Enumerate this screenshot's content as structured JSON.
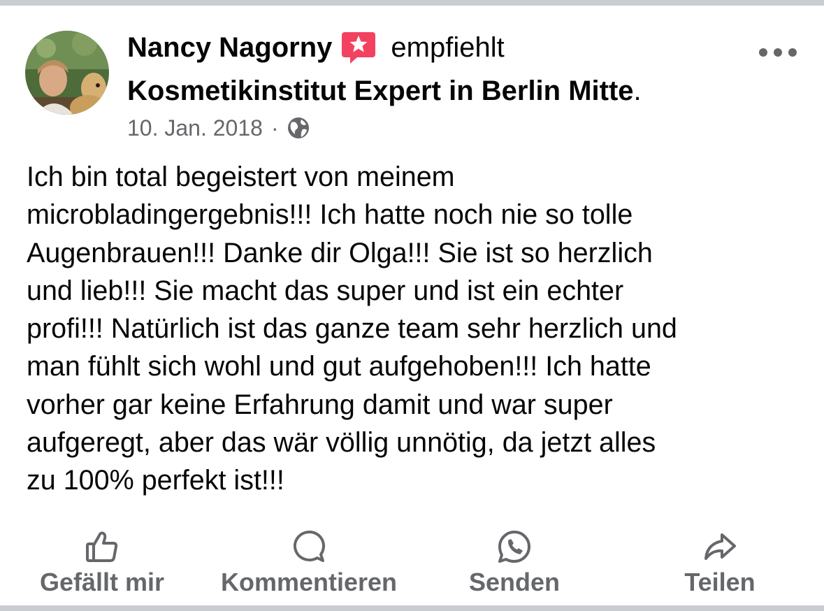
{
  "post": {
    "author": "Nancy Nagorny",
    "action_text": "empfiehlt",
    "page_name": "Kosmetikinstitut Expert in Berlin Mitte",
    "page_suffix": ".",
    "date": "10. Jan. 2018",
    "separator": "·",
    "privacy_icon": "globe-icon",
    "recommend_icon": "recommendation-star-icon",
    "menu_icon": "more-options-icon",
    "body_lines": [
      "Ich bin total begeistert von meinem",
      "microbladingergebnis!!! Ich hatte noch nie so tolle",
      "Augenbrauen!!! Danke dir Olga!!! Sie ist so herzlich",
      "und lieb!!! Sie macht das super und ist ein echter",
      "profi!!! Natürlich ist das ganze team sehr herzlich und",
      "man fühlt sich wohl und gut aufgehoben!!! Ich hatte",
      "vorher gar keine Erfahrung damit und war super",
      "aufgeregt, aber das wär völlig unnötig, da jetzt alles",
      "zu 100% perfekt ist!!!"
    ]
  },
  "actions": {
    "like": {
      "label": "Gefällt mir",
      "icon": "thumbs-up-icon"
    },
    "comment": {
      "label": "Kommentieren",
      "icon": "comment-bubble-icon"
    },
    "send": {
      "label": "Senden",
      "icon": "whatsapp-icon"
    },
    "share": {
      "label": "Teilen",
      "icon": "share-arrow-icon"
    }
  },
  "colors": {
    "text_primary": "#050505",
    "text_secondary": "#65676b",
    "divider": "#c9ccd1",
    "badge_red": "#f3425f"
  }
}
